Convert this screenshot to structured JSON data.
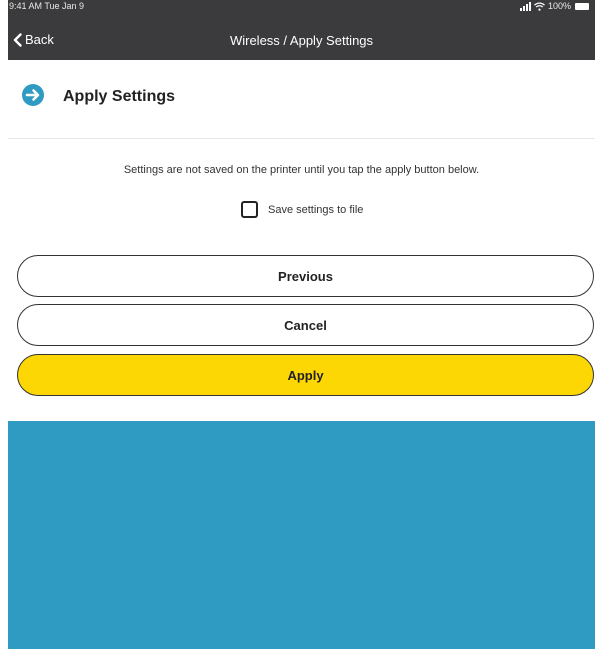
{
  "status_bar": {
    "time_date": "9:41 AM  Tue Jan 9",
    "battery": "100%"
  },
  "nav": {
    "back_label": "Back",
    "title": "Wireless / Apply Settings"
  },
  "section": {
    "title": "Apply Settings",
    "icon": "arrow-right-circle-icon"
  },
  "info_text": "Settings are not saved on the printer until you tap the apply button below.",
  "save_to_file": {
    "label": "Save settings to file",
    "checked": false
  },
  "buttons": {
    "previous": "Previous",
    "cancel": "Cancel",
    "apply": "Apply"
  },
  "colors": {
    "nav_background": "#3b3b3d",
    "accent_blue": "#2f9ac2",
    "apply_yellow": "#fdd703"
  }
}
